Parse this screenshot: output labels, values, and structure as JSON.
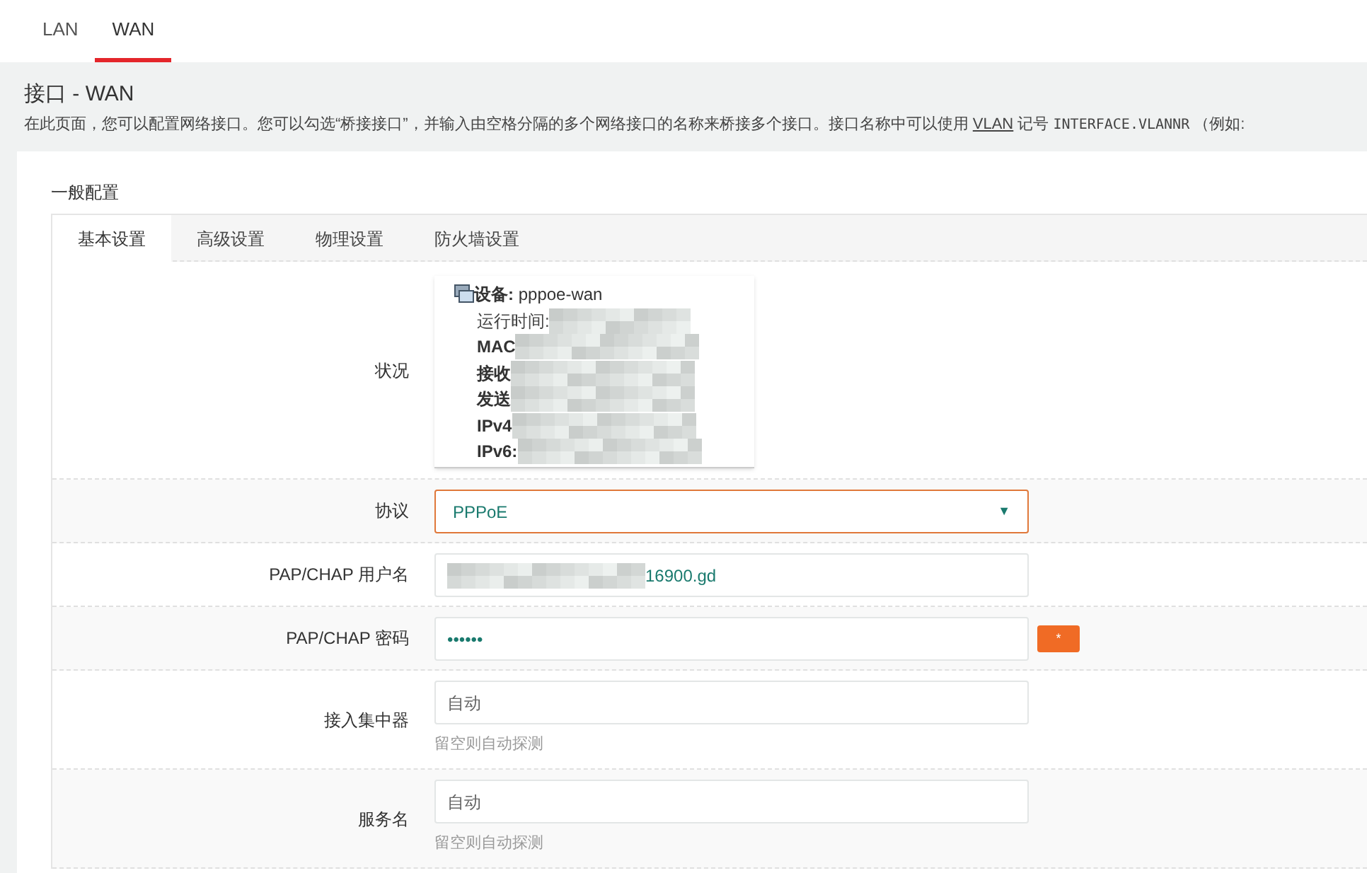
{
  "top_tabs": [
    {
      "label": "LAN",
      "selected": false
    },
    {
      "label": "WAN",
      "selected": true
    }
  ],
  "page": {
    "title": "接口 - WAN",
    "description_before": "在此页面，您可以配置网络接口。您可以勾选“桥接接口”，并输入由空格分隔的多个网络接口的名称来桥接多个接口。接口名称中可以使用",
    "link": "VLAN",
    "description_mid": "记号",
    "code": "INTERFACE.VLANNR",
    "description_after": "（例如:"
  },
  "section": {
    "title": "一般配置",
    "tabs": [
      {
        "label": "基本设置",
        "selected": true
      },
      {
        "label": "高级设置",
        "selected": false
      },
      {
        "label": "物理设置",
        "selected": false
      },
      {
        "label": "防火墙设置",
        "selected": false
      }
    ],
    "status": {
      "label": "状况",
      "device_label": "设备:",
      "device": "pppoe-wan",
      "lines": [
        {
          "text": "运行时间:",
          "bold": false
        },
        {
          "text": "MAC",
          "bold": true
        },
        {
          "text": "接收",
          "bold": true
        },
        {
          "text": "发送",
          "bold": true
        },
        {
          "text": "IPv4",
          "bold": true
        },
        {
          "text": "IPv6:",
          "bold": true
        }
      ]
    },
    "fields": [
      {
        "kind": "select",
        "label": "协议",
        "value": "PPPoE",
        "caret": "▼"
      },
      {
        "kind": "text",
        "label": "PAP/CHAP 用户名",
        "value": "16900.gd",
        "redacted": true
      },
      {
        "kind": "password",
        "label": "PAP/CHAP 密码",
        "value": "••••••",
        "reveal": "*"
      },
      {
        "kind": "text",
        "label": "接入集中器",
        "placeholder": "自动",
        "hint": "留空则自动探测"
      },
      {
        "kind": "text",
        "label": "服务名",
        "placeholder": "自动",
        "hint": "留空则自动探测"
      }
    ]
  }
}
